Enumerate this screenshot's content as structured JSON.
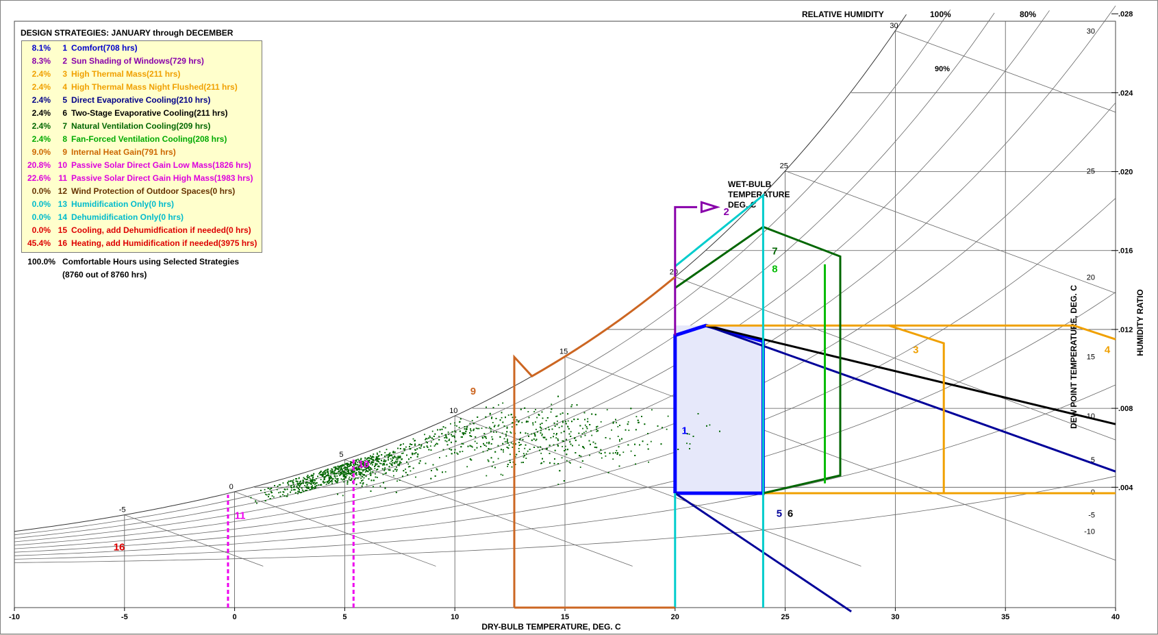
{
  "legend": {
    "title": "DESIGN STRATEGIES:  JANUARY through DECEMBER",
    "items": [
      {
        "pct": "8.1%",
        "num": "1",
        "label": "Comfort(708 hrs)",
        "color": "#0000cc"
      },
      {
        "pct": "8.3%",
        "num": "2",
        "label": "Sun Shading of Windows(729 hrs)",
        "color": "#8800aa"
      },
      {
        "pct": "2.4%",
        "num": "3",
        "label": "High Thermal Mass(211 hrs)",
        "color": "#f0a000"
      },
      {
        "pct": "2.4%",
        "num": "4",
        "label": "High Thermal Mass Night Flushed(211 hrs)",
        "color": "#f0a000"
      },
      {
        "pct": "2.4%",
        "num": "5",
        "label": "Direct Evaporative Cooling(210 hrs)",
        "color": "#000088"
      },
      {
        "pct": "2.4%",
        "num": "6",
        "label": "Two-Stage Evaporative Cooling(211 hrs)",
        "color": "#000000"
      },
      {
        "pct": "2.4%",
        "num": "7",
        "label": "Natural Ventilation Cooling(209 hrs)",
        "color": "#006600"
      },
      {
        "pct": "2.4%",
        "num": "8",
        "label": "Fan-Forced Ventilation Cooling(208 hrs)",
        "color": "#00aa00"
      },
      {
        "pct": "9.0%",
        "num": "9",
        "label": "Internal Heat Gain(791 hrs)",
        "color": "#cc6600"
      },
      {
        "pct": "20.8%",
        "num": "10",
        "label": "Passive Solar Direct Gain Low Mass(1826 hrs)",
        "color": "#dd00dd"
      },
      {
        "pct": "22.6%",
        "num": "11",
        "label": "Passive Solar Direct Gain High Mass(1983 hrs)",
        "color": "#dd00dd"
      },
      {
        "pct": "0.0%",
        "num": "12",
        "label": "Wind Protection of Outdoor Spaces(0 hrs)",
        "color": "#663300"
      },
      {
        "pct": "0.0%",
        "num": "13",
        "label": "Humidification Only(0 hrs)",
        "color": "#00bbcc"
      },
      {
        "pct": "0.0%",
        "num": "14",
        "label": "Dehumidification Only(0 hrs)",
        "color": "#00bbcc"
      },
      {
        "pct": "0.0%",
        "num": "15",
        "label": "Cooling, add Dehumidfication if needed(0 hrs)",
        "color": "#dd0000"
      },
      {
        "pct": "45.4%",
        "num": "16",
        "label": "Heating, add Humidification if needed(3975 hrs)",
        "color": "#dd0000"
      }
    ]
  },
  "summary": {
    "pct": "100.0%",
    "line1": "Comfortable Hours using Selected Strategies",
    "line2": "(8760 out of 8760 hrs)"
  },
  "chart_data": {
    "type": "scatter",
    "xlabel": "DRY-BULB TEMPERATURE, DEG. C",
    "xlim": [
      -10,
      40
    ],
    "x_ticks": [
      "-10",
      "-5",
      "0",
      "5",
      "10",
      "15",
      "20",
      "25",
      "30",
      "35",
      "40"
    ],
    "ylabel_right": "HUMIDITY RATIO",
    "ylabel_dewpoint": "DEW POINT TEMPERATURE, DEG. C",
    "wetbulb_label": [
      "WET-BULB",
      "TEMPERATURE",
      "DEG. C"
    ],
    "rh_label": "RELATIVE HUMIDITY",
    "rh_ticks": [
      "100%",
      "90%",
      "80%"
    ],
    "humidity_ticks": [
      {
        "w": 0.004,
        "label": ".004"
      },
      {
        "w": 0.008,
        "label": ".008"
      },
      {
        "w": 0.012,
        "label": ".012"
      },
      {
        "w": 0.016,
        "label": ".016"
      },
      {
        "w": 0.02,
        "label": ".020"
      },
      {
        "w": 0.024,
        "label": ".024"
      },
      {
        "w": 0.028,
        "label": ".028"
      }
    ],
    "dewpoint_ticks": [
      "-10",
      "-5",
      "0",
      "5",
      "10",
      "15",
      "20",
      "25",
      "30"
    ],
    "wetbulb_ticks": [
      "-5",
      "0",
      "5",
      "10",
      "15",
      "20",
      "25",
      "30"
    ],
    "zone_labels": [
      "1",
      "2",
      "3",
      "4",
      "5",
      "6",
      "7",
      "8",
      "9",
      "10",
      "11",
      "16"
    ],
    "points_description": "8760 hourly points spanning about -2 to 27 °C",
    "point_color": "#006600",
    "zones": {
      "comfort": {
        "tdb_min": 20,
        "tdb_max": 24,
        "w_min": 0.0037,
        "w_max": 0.0122
      },
      "shading_tdb": 20,
      "internal_gain_tdb": 12.7,
      "passive_solar_tdb": [
        -0.3,
        5.4
      ],
      "humidification_tdb": [
        20,
        24
      ],
      "thermal_mass_tdb_max": 32.2,
      "ventilation_tdb_max": [
        26.8,
        27.5
      ]
    },
    "colors": {
      "comfort": "#0000ff",
      "shading": "#8800aa",
      "thermal_mass": "#f0a000",
      "evap": "#000099",
      "two_stage": "#000000",
      "natvent": "#006600",
      "fanvent": "#00bb00",
      "internal_gain": "#cc6622",
      "passive": "#ee00ee",
      "cyan": "#00cccc",
      "heating": "#dd0000"
    }
  }
}
